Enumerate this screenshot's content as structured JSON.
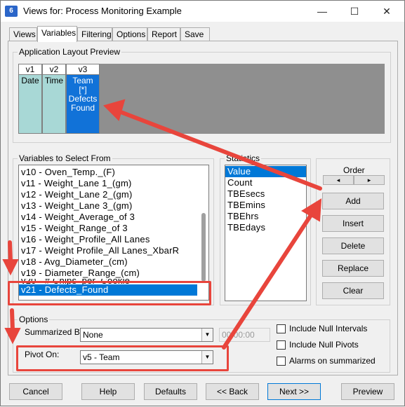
{
  "window": {
    "title": "Views for: Process Monitoring Example",
    "app_icon_text": "6"
  },
  "titlebar_buttons": {
    "minimize": "—",
    "maximize": "☐",
    "close": "✕"
  },
  "tabs": [
    "Views",
    "Variables",
    "Filtering",
    "Options",
    "Report",
    "Save"
  ],
  "active_tab": "Variables",
  "layout_preview": {
    "label": "Application Layout Preview",
    "columns": [
      {
        "header": "v1",
        "body": "Date"
      },
      {
        "header": "v2",
        "body": "Time"
      },
      {
        "header": "v3",
        "body": "Team\n[*]\nDefects\nFound",
        "selected": true
      }
    ]
  },
  "variables": {
    "label": "Variables to Select From",
    "items": [
      "v10 - Oven_Temp._(F)",
      "v11 - Weight_Lane 1_(gm)",
      "v12 - Weight_Lane 2_(gm)",
      "v13 - Weight_Lane 3_(gm)",
      "v14 - Weight_Average_of 3",
      "v15 - Weight_Range_of 3",
      "v16 - Weight_Profile_All Lanes",
      "v17 - Weight Profile_All Lanes_XbarR",
      "v18 - Avg_Diameter_(cm)",
      "v19 - Diameter_Range_(cm)",
      "v20 - # Chips_per_Cookie",
      "v21 - Defects_Found"
    ],
    "selected": "v21 - Defects_Found"
  },
  "statistics": {
    "label": "Statistics",
    "items": [
      "Value",
      "Count",
      "TBEsecs",
      "TBEmins",
      "TBEhrs",
      "TBEdays"
    ],
    "selected": "Value"
  },
  "order": {
    "label": "Order",
    "left": "◂",
    "right": "▸"
  },
  "action_buttons": {
    "add": "Add",
    "insert": "Insert",
    "delete": "Delete",
    "replace": "Replace",
    "clear": "Clear"
  },
  "options": {
    "label": "Options",
    "summarized_by_label": "Summarized By:",
    "summarized_by_value": "None",
    "time_value": "00:00:00",
    "pivot_on_label": "Pivot On:",
    "pivot_on_value": "v5 - Team",
    "checkboxes": [
      "Include Null Intervals",
      "Include Null Pivots",
      "Alarms on summarized"
    ]
  },
  "bottom_buttons": {
    "cancel": "Cancel",
    "help": "Help",
    "defaults": "Defaults",
    "back": "<< Back",
    "next": "Next >>",
    "preview": "Preview"
  },
  "annotation_color": "#e8453c"
}
